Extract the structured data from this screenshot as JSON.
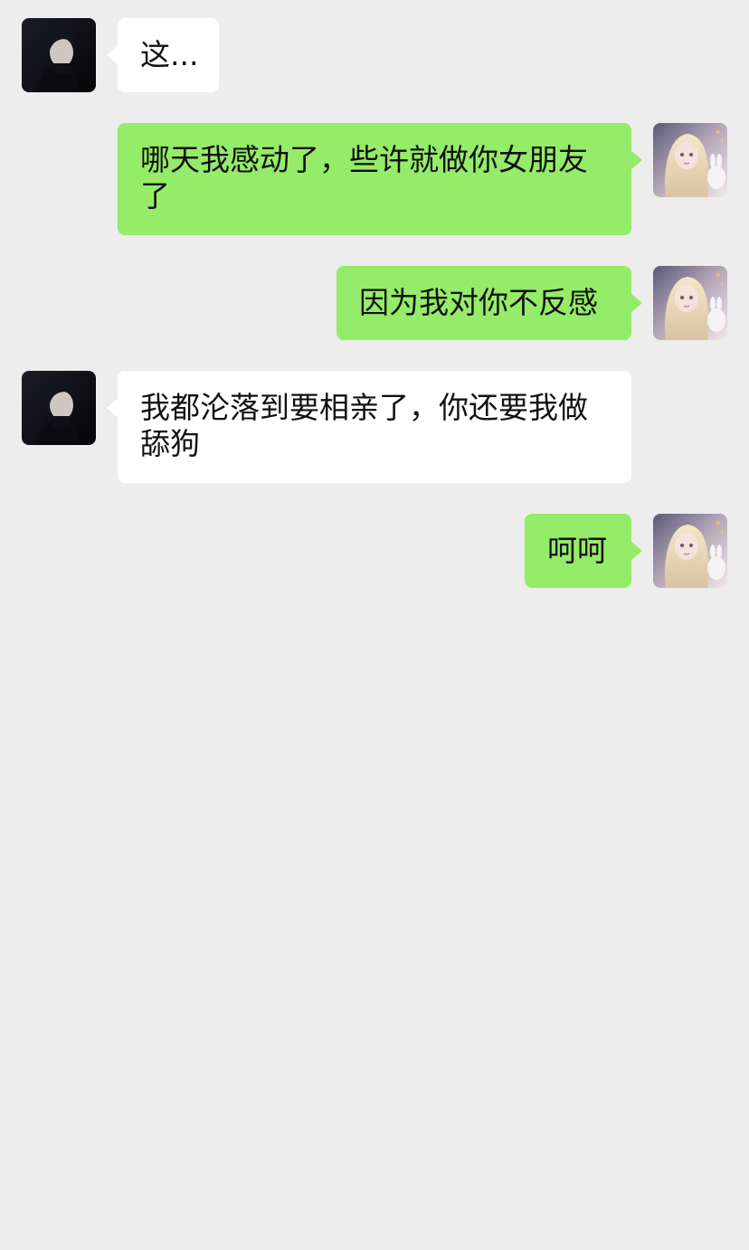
{
  "messages": [
    {
      "side": "left",
      "sender": "boy-avatar",
      "text": "这..."
    },
    {
      "side": "right",
      "sender": "girl-avatar",
      "text": "哪天我感动了，些许就做你女朋友了"
    },
    {
      "side": "right",
      "sender": "girl-avatar",
      "text": "因为我对你不反感"
    },
    {
      "side": "left",
      "sender": "boy-avatar",
      "text": "我都沦落到要相亲了，你还要我做舔狗"
    },
    {
      "side": "right",
      "sender": "girl-avatar",
      "text": "呵呵"
    }
  ],
  "colors": {
    "background": "#ededed",
    "incoming_bubble": "#ffffff",
    "outgoing_bubble": "#95ec69",
    "text": "#111111"
  }
}
